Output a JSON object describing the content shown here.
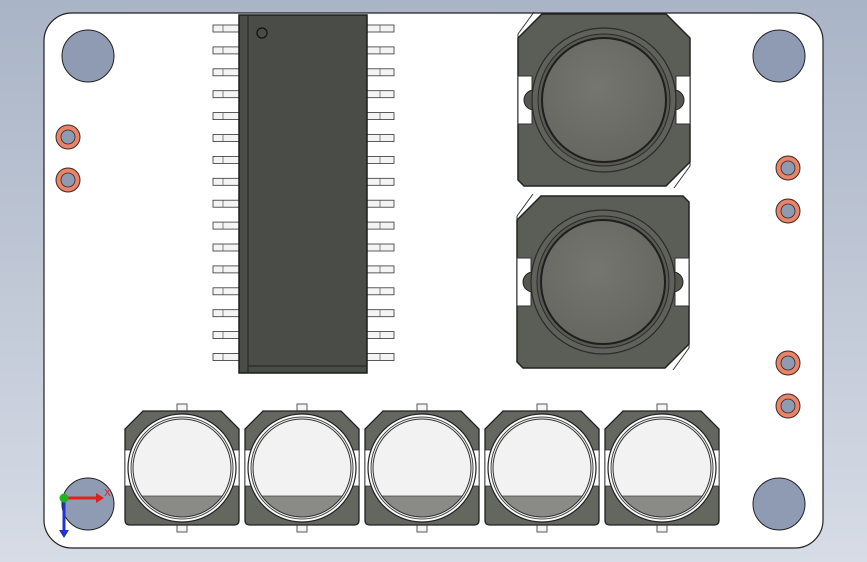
{
  "viewport": {
    "background_top": "#a9b4c6",
    "background_bottom": "#d7dce6"
  },
  "pcb": {
    "board_color": "#ffffff",
    "mount_hole_color": "#8f9bb2",
    "pad_ring_color": "#e9836a",
    "pad_hole_color": "#8f9bb2"
  },
  "ic": {
    "body_color": "#4a4c47",
    "pin_count_per_side": 16,
    "pin1_marker": "circle"
  },
  "inductors": {
    "count": 2,
    "body_color": "#5b5d57",
    "core_color": "#6e706a"
  },
  "capacitors": {
    "count": 5,
    "base_color": "#646660",
    "top_color": "#ffffff"
  },
  "triad": {
    "x_label": "X",
    "x_color": "#e0201e",
    "y_color": "#1fb31f",
    "z_color": "#2032cf"
  }
}
